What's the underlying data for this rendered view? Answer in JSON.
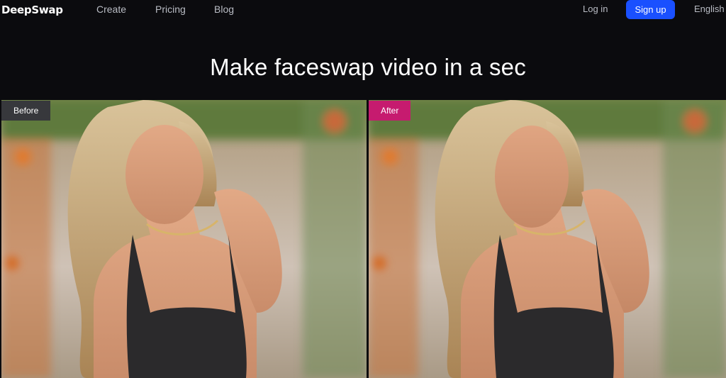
{
  "header": {
    "logo": "DeepSwap",
    "nav": {
      "create": "Create",
      "pricing": "Pricing",
      "blog": "Blog"
    },
    "login": "Log in",
    "signup": "Sign up",
    "language": "English"
  },
  "hero": {
    "title": "Make faceswap video in a sec"
  },
  "compare": {
    "before_label": "Before",
    "after_label": "After",
    "before_badge_color": "#37383c",
    "after_badge_color": "#c61b6f"
  },
  "colors": {
    "background": "#0b0b0e",
    "accent": "#1a50ff",
    "nav_text": "#b9bcc4"
  }
}
